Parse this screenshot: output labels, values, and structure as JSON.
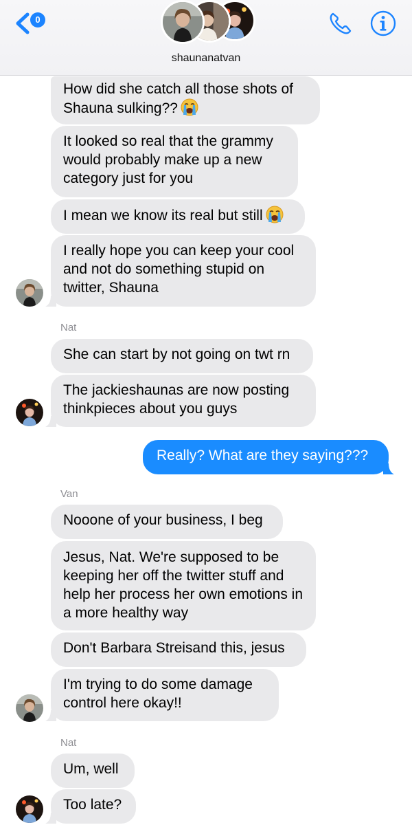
{
  "header": {
    "back_badge": "0",
    "title": "shaunanatvan"
  },
  "icons": {
    "back": "chevron-left-icon",
    "call": "phone-icon",
    "info": "info-icon",
    "emoji": "loudly-crying-face-icon"
  },
  "colors": {
    "accent": "#1a8cff",
    "received_bubble": "#e9e9eb",
    "sender_label": "#8e8e93"
  },
  "messages": [
    {
      "direction": "received",
      "text": "How did she catch all those shots of Shauna sulking??",
      "emoji": true
    },
    {
      "direction": "received",
      "text": "It looked so real that the grammy would probably make up a new category just for you"
    },
    {
      "direction": "received",
      "text": "I mean we know its real but still",
      "emoji": true
    },
    {
      "direction": "received",
      "text": "I really hope you can keep your cool and not do something stupid on twitter, Shauna"
    },
    {
      "direction": "received",
      "sender": "Nat",
      "text": "She can start by not going on twt rn"
    },
    {
      "direction": "received",
      "text": "The jackieshaunas are now posting thinkpieces about you guys"
    },
    {
      "direction": "sent",
      "text": "Really? What are they saying???"
    },
    {
      "direction": "received",
      "sender": "Van",
      "text": "Nooone of your business, I beg"
    },
    {
      "direction": "received",
      "text": "Jesus, Nat. We're supposed to be keeping her off the twitter stuff and help her process her own emotions in a more healthy way"
    },
    {
      "direction": "received",
      "text": "Don't Barbara Streisand this, jesus"
    },
    {
      "direction": "received",
      "text": "I'm trying to do some damage control here okay!!"
    },
    {
      "direction": "received",
      "sender": "Nat",
      "text": "Um, well"
    },
    {
      "direction": "received",
      "text": "Too late?"
    }
  ]
}
